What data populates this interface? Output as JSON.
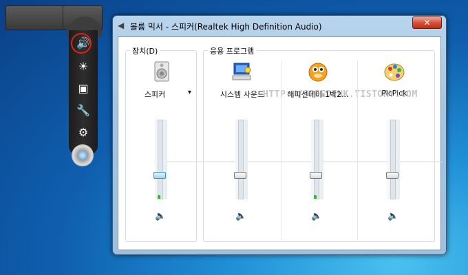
{
  "window": {
    "title": "볼륨 믹서 - 스피커(Realtek High Definition Audio)",
    "close_label": "✕"
  },
  "device_group": {
    "label": "장치(D)",
    "channel": {
      "name": "스피커",
      "dropdown_label": "▾",
      "icon": "speaker-device-icon"
    }
  },
  "app_group": {
    "label": "응용 프로그램",
    "channels": [
      {
        "name": "시스템 사운드",
        "icon": "system-sounds-icon"
      },
      {
        "name": "해피선데이-1박2...",
        "icon": "gom-player-icon"
      },
      {
        "name": "PicPick",
        "icon": "picpick-palette-icon"
      }
    ]
  },
  "watermark": "HTTP://SPEEDINK.TISTORY.COM",
  "gadget": {
    "icons": [
      "speaker-icon",
      "sun-icon",
      "window-icon",
      "wrench-icon",
      "gear-icon"
    ]
  },
  "colors": {
    "accent": "#3d8cc8",
    "close": "#c02e14",
    "meter": "#31b533",
    "highlight_ring": "#e0201a"
  }
}
